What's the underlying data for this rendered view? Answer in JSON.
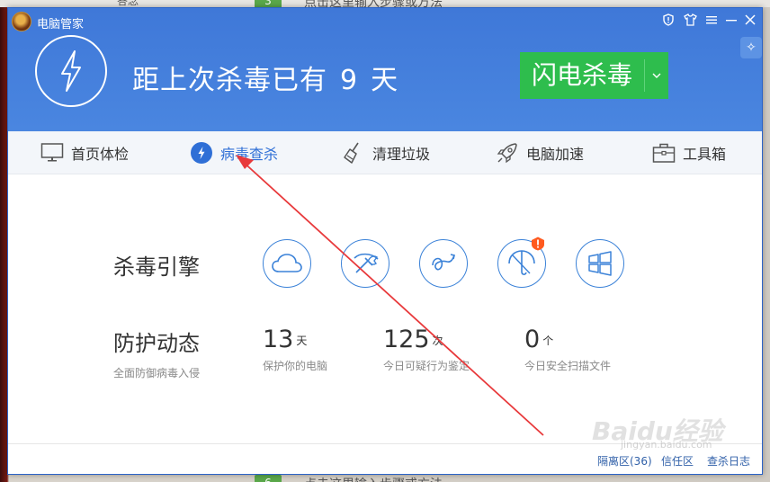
{
  "background": {
    "text_top": "点击这里输入步骤或方法",
    "badge_top": "3",
    "text_bottom": "点击这里输入步骤或方法",
    "badge_bottom": "6",
    "left_text": "答念"
  },
  "window": {
    "app_title": "电脑管家",
    "titlebar_icons": [
      "shield-alert-icon",
      "tshirt-icon",
      "menu-icon",
      "minimize-icon",
      "close-icon"
    ],
    "status": {
      "prefix": "距上次杀毒已有",
      "days": "9",
      "suffix": "天"
    },
    "scan_button": "闪电杀毒",
    "accent": "#4a86e0",
    "button_color": "#2ebd4d"
  },
  "tabs": [
    {
      "label": "首页体检",
      "icon": "monitor-icon"
    },
    {
      "label": "病毒查杀",
      "icon": "bolt-icon",
      "active": true
    },
    {
      "label": "清理垃圾",
      "icon": "broom-icon"
    },
    {
      "label": "电脑加速",
      "icon": "rocket-icon"
    },
    {
      "label": "工具箱",
      "icon": "toolbox-icon"
    }
  ],
  "engines": {
    "label": "杀毒引擎",
    "icons": [
      "cloud-engine-icon",
      "system-repair-icon",
      "behavior-engine-icon",
      "anti-virus-umbrella-icon",
      "windows-engine-icon"
    ],
    "warning_icon": "warning-badge-icon"
  },
  "protection": {
    "label": "防护动态",
    "sublabel": "全面防御病毒入侵",
    "stats": [
      {
        "value": "13",
        "unit": "天",
        "caption": "保护你的电脑"
      },
      {
        "value": "125",
        "unit": "次",
        "caption": "今日可疑行为鉴定"
      },
      {
        "value": "0",
        "unit": "个",
        "caption": "今日安全扫描文件"
      }
    ]
  },
  "footer": {
    "links": [
      "隔离区(36)",
      "信任区",
      "查杀日志"
    ]
  },
  "watermark": {
    "brand": "Baidu经验",
    "url": "jingyan.baidu.com"
  }
}
